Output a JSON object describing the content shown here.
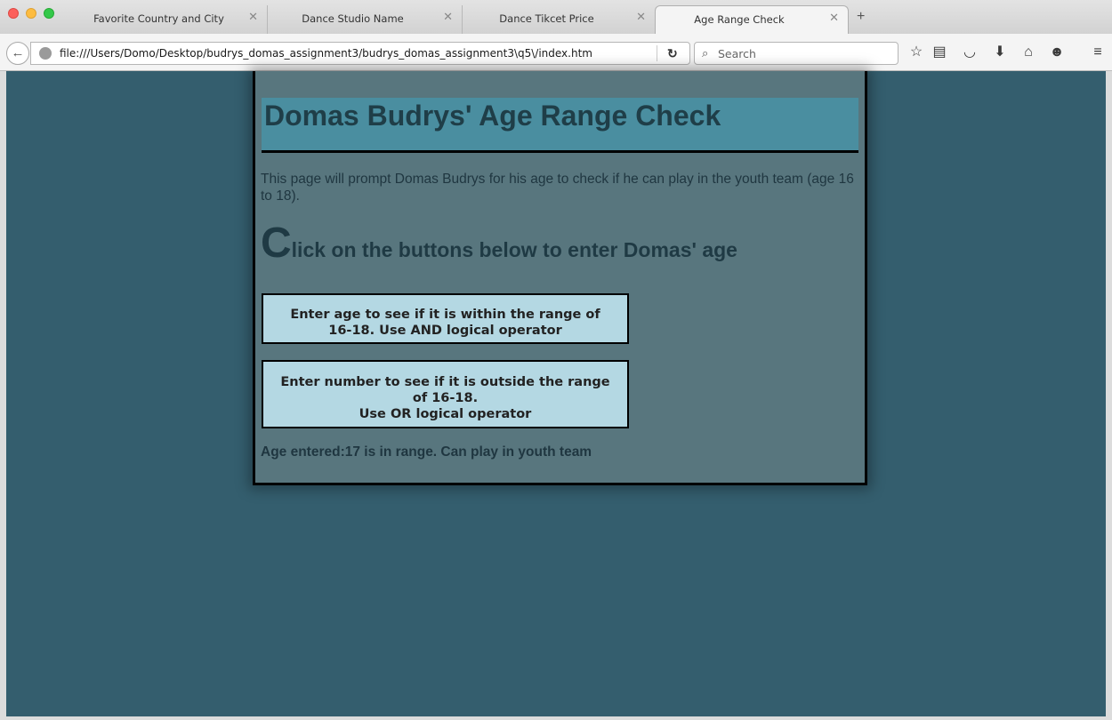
{
  "browser": {
    "tabs": [
      {
        "label": "Favorite Country and City"
      },
      {
        "label": "Dance Studio Name"
      },
      {
        "label": "Dance Tikcet Price"
      },
      {
        "label": "Age Range Check"
      }
    ],
    "new_tab_label": "+",
    "url": "file:///Users/Domo/Desktop/budrys_domas_assignment3/budrys_domas_assignment3\\q5\\/index.htm",
    "search_placeholder": "Search",
    "icons": [
      "back-arrow-icon",
      "globe-icon",
      "reload-icon",
      "search-icon",
      "bookmark-star-icon",
      "reading-list-icon",
      "pocket-icon",
      "download-icon",
      "home-icon",
      "chat-icon",
      "hamburger-menu-icon"
    ]
  },
  "page": {
    "title": "Domas Budrys' Age Range Check",
    "intro": "This page will prompt Domas Budrys for his age to check if he can play in the youth team (age 16 to 18).",
    "subheading_first_letter": "C",
    "subheading_rest": "lick on the buttons below to enter Domas' age",
    "button_and": "Enter age to see if it is within the range of\n16-18. Use AND logical operator",
    "button_or": "Enter number to see if it is outside the range\nof 16-18.\nUse OR logical operator",
    "result": "Age entered:17 is in range. Can play in youth team"
  },
  "colors": {
    "page_background": "#345e6e",
    "container_background": "#58767e",
    "header_band": "#4a8ea0",
    "button_background": "#b4d8e3"
  }
}
